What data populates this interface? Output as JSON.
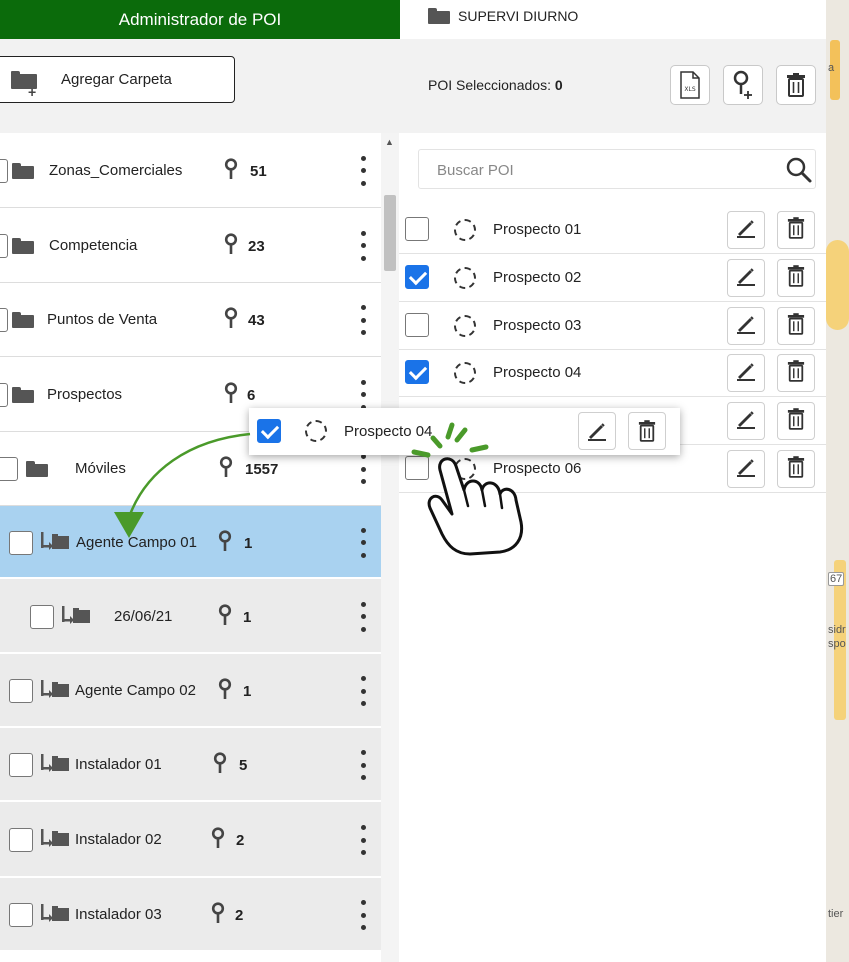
{
  "tabs": {
    "active": "Administrador de POI",
    "inactive": "SUPERVI DIURNO"
  },
  "toolbar": {
    "add_folder_label": "Agregar Carpeta",
    "selected_label": "POI Seleccionados:",
    "selected_count": "0",
    "xls_label": "XLS"
  },
  "folders": [
    {
      "name": "Zonas_Comerciales",
      "count": "51"
    },
    {
      "name": "Competencia",
      "count": "23"
    },
    {
      "name": "Puntos de Venta",
      "count": "43"
    },
    {
      "name": "Prospectos",
      "count": "6"
    },
    {
      "name": "Móviles",
      "count": "1557"
    }
  ],
  "subfolders": [
    {
      "name": "Agente Campo 01",
      "count": "1"
    },
    {
      "name": "26/06/21",
      "count": "1"
    },
    {
      "name": "Agente Campo 02",
      "count": "1"
    },
    {
      "name": "Instalador 01",
      "count": "5"
    },
    {
      "name": "Instalador 02",
      "count": "2"
    },
    {
      "name": "Instalador 03",
      "count": "2"
    }
  ],
  "search": {
    "placeholder": "Buscar POI"
  },
  "pois": [
    {
      "name": "Prospecto 01",
      "checked": false
    },
    {
      "name": "Prospecto 02",
      "checked": true
    },
    {
      "name": "Prospecto 03",
      "checked": false
    },
    {
      "name": "Prospecto 04",
      "checked": true
    },
    {
      "name": "",
      "checked": false
    },
    {
      "name": "Prospecto 06",
      "checked": false
    }
  ],
  "drag_card": {
    "name": "Prospecto 04",
    "checked": true
  },
  "map": {
    "labels": [
      "a",
      "67",
      "sidr",
      "spo",
      "tier"
    ]
  },
  "colors": {
    "tab_active": "#0b6b0b",
    "highlight": "#a9d2f0",
    "checkbox": "#1a73e8",
    "arrow": "#4a9a2a",
    "click_burst": "#4a9a2a"
  }
}
